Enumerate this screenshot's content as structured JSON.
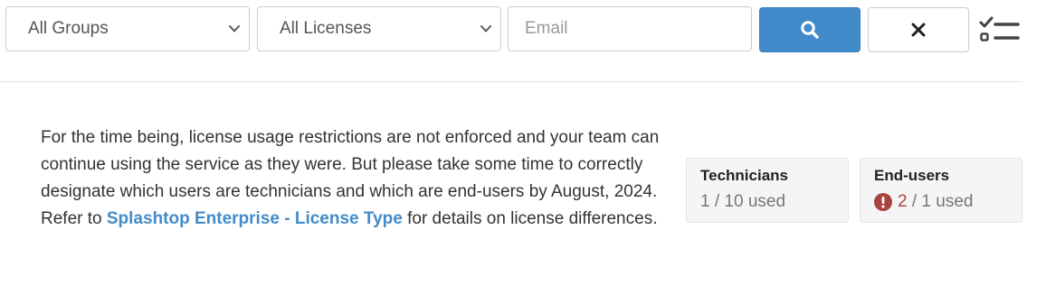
{
  "filters": {
    "group": {
      "selected": "All Groups"
    },
    "license": {
      "selected": "All Licenses"
    },
    "email": {
      "placeholder": "Email",
      "value": ""
    },
    "search_icon": "search-icon",
    "clear_icon": "close-icon",
    "checklist_icon": "checklist-icon"
  },
  "notice": {
    "text_before": "For the time being, license usage restrictions are not enforced and your team can continue using the service as they were. But please take some time to correctly designate which users are technicians and which are end-users by August, 2024. Refer to ",
    "link_text": "Splashtop Enterprise - License Type",
    "text_after": " for details on license differences."
  },
  "license_cards": {
    "technicians": {
      "title": "Technicians",
      "used": "1",
      "separator": " / ",
      "total": "10",
      "suffix": " used"
    },
    "end_users": {
      "title": "End-users",
      "used": "2",
      "separator": " / ",
      "total": "1",
      "suffix": " used",
      "warning_icon": "exclamation-circle-icon"
    }
  },
  "colors": {
    "primary": "#428bca",
    "link": "#428bca",
    "danger": "#a94442",
    "card_bg": "#f5f5f5"
  }
}
